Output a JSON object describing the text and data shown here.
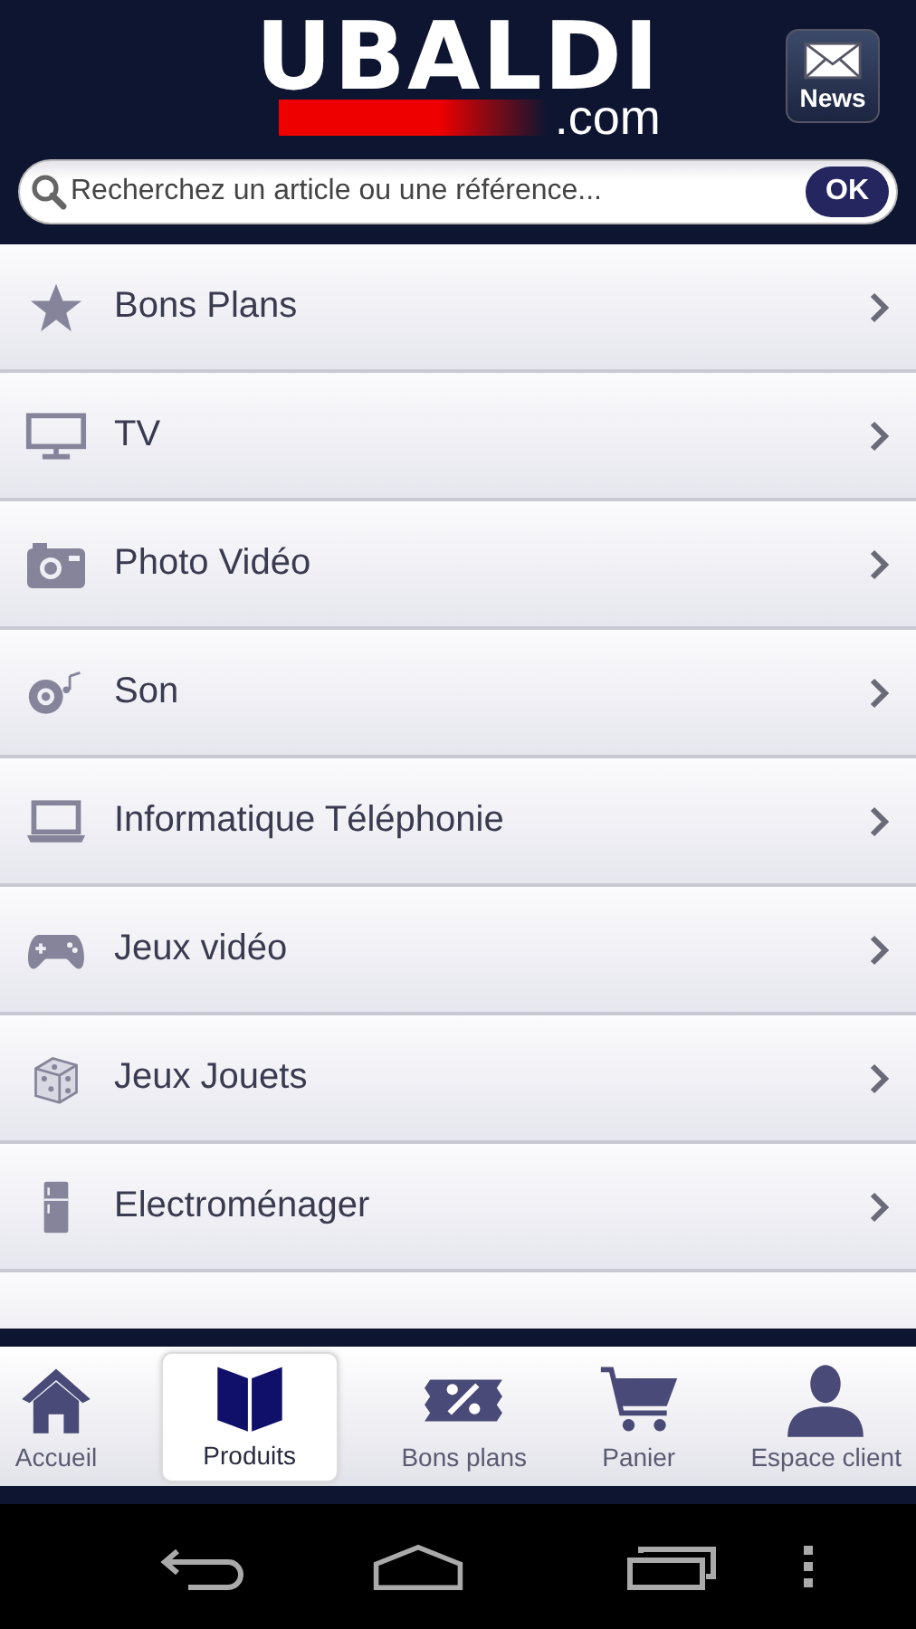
{
  "header": {
    "logo": "UBALDI",
    "logo_suffix": ".com",
    "news_button": "News"
  },
  "search": {
    "placeholder": "Recherchez un article ou une référence...",
    "button": "OK"
  },
  "categories": [
    {
      "label": "Bons Plans",
      "kind": "star"
    },
    {
      "label": "TV",
      "kind": "tv"
    },
    {
      "label": "Photo Vidéo",
      "kind": "camera"
    },
    {
      "label": "Son",
      "kind": "speaker"
    },
    {
      "label": "Informatique Téléphonie",
      "kind": "laptop"
    },
    {
      "label": "Jeux vidéo",
      "kind": "gamepad"
    },
    {
      "label": "Jeux Jouets",
      "kind": "dice"
    },
    {
      "label": "Electroménager",
      "kind": "fridge"
    }
  ],
  "tabs": [
    {
      "label": "Accueil",
      "kind": "home",
      "selected": false
    },
    {
      "label": "Produits",
      "kind": "book",
      "selected": true
    },
    {
      "label": "Bons plans",
      "kind": "percent",
      "selected": false
    },
    {
      "label": "Panier",
      "kind": "cart",
      "selected": false
    },
    {
      "label": "Espace client",
      "kind": "person",
      "selected": false
    }
  ]
}
